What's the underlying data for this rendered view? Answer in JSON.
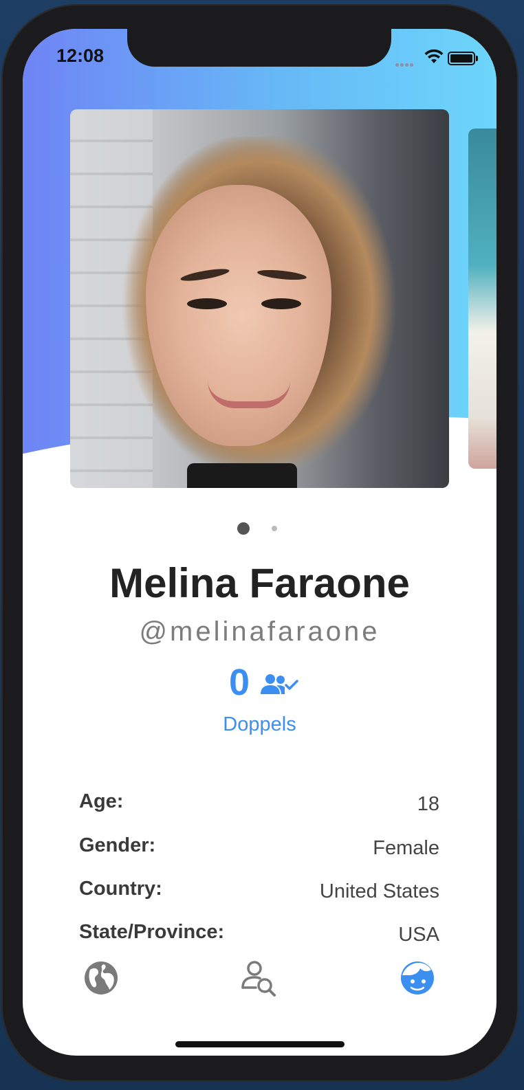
{
  "status_bar": {
    "time": "12:08"
  },
  "profile": {
    "name": "Melina Faraone",
    "username": "@melinafaraone",
    "doppels_count": "0",
    "doppels_label": "Doppels",
    "photo_page_count": 2,
    "photo_page_active": 1
  },
  "info": [
    {
      "label": "Age:",
      "value": "18"
    },
    {
      "label": "Gender:",
      "value": "Female"
    },
    {
      "label": "Country:",
      "value": "United States"
    },
    {
      "label": "State/Province:",
      "value": "USA"
    }
  ],
  "tabs": [
    {
      "icon": "globe-icon",
      "active": false
    },
    {
      "icon": "user-search-icon",
      "active": false
    },
    {
      "icon": "profile-face-icon",
      "active": true
    }
  ],
  "colors": {
    "accent": "#3b8ff0",
    "gradient_start": "#6f84f5",
    "gradient_end": "#6dd6fb",
    "inactive_icon": "#777777"
  }
}
